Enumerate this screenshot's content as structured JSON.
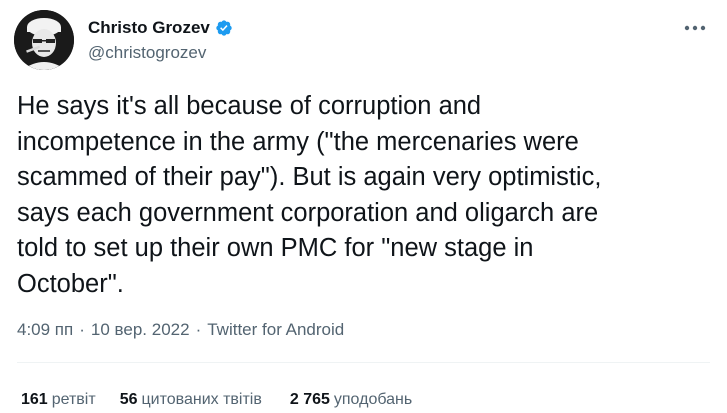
{
  "author": {
    "display_name": "Christo Grozev",
    "handle": "@christogrozev",
    "verified": true,
    "avatar_icon": "profile-photo"
  },
  "tweet": {
    "text": "He says it's all because of corruption and\nincompetence in the army (\"the mercenaries were\nscammed of their pay\"). But is again very optimistic,\nsays each government corporation and oligarch are\ntold to set up their own PMC for \"new stage in\nOctober\"."
  },
  "meta": {
    "time": "4:09 пп",
    "separator": "·",
    "date": "10 вер. 2022",
    "source": "Twitter for Android"
  },
  "stats": {
    "retweets_count": "161",
    "retweets_label": "ретвіт",
    "quotes_count": "56",
    "quotes_label": "цитованих твітів",
    "likes_count": "2 765",
    "likes_label": "уподобань"
  },
  "colors": {
    "text": "#0f1419",
    "secondary": "#536471",
    "verified": "#1d9bf0",
    "divider": "#eff3f4"
  }
}
